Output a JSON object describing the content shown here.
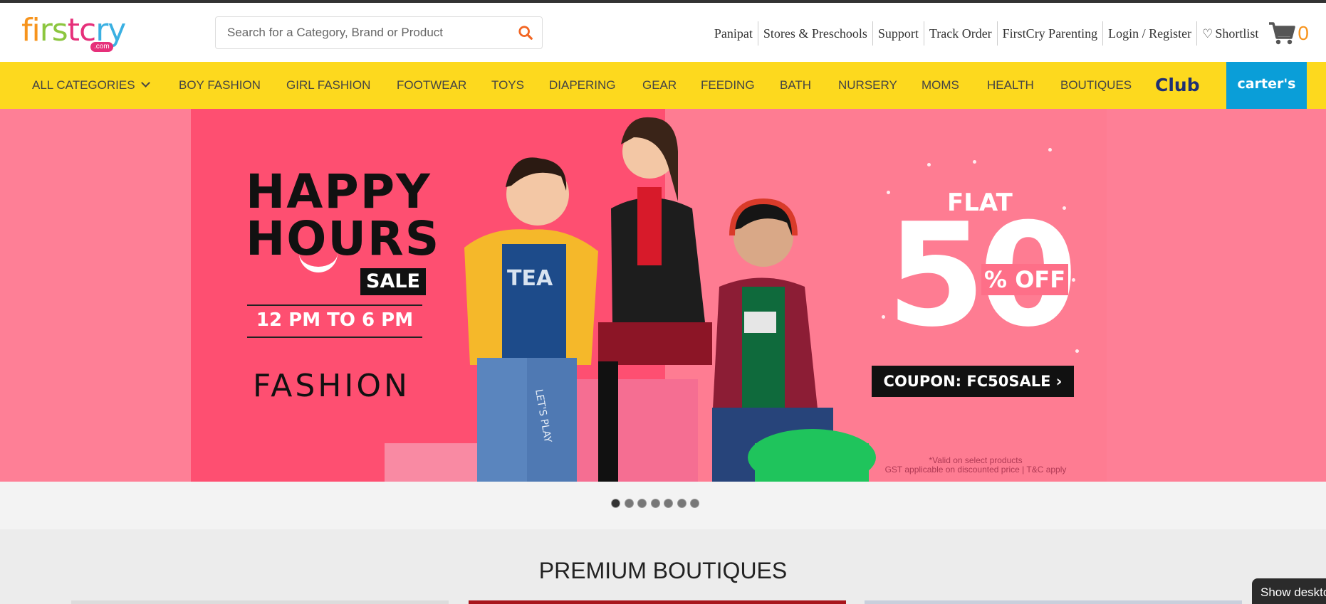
{
  "header": {
    "logo_text": "firstcry",
    "logo_sub": ".com",
    "search_placeholder": "Search for a Category, Brand or Product",
    "links": [
      "Panipat",
      "Stores & Preschools",
      "Support",
      "Track Order",
      "FirstCry Parenting",
      "Login / Register",
      "Shortlist"
    ],
    "cart_count": "0"
  },
  "nav": {
    "items": [
      "ALL CATEGORIES",
      "BOY FASHION",
      "GIRL FASHION",
      "FOOTWEAR",
      "TOYS",
      "DIAPERING",
      "GEAR",
      "FEEDING",
      "BATH",
      "NURSERY",
      "MOMS",
      "HEALTH",
      "BOUTIQUES"
    ],
    "club_label": "Club",
    "carters_label": "carter's"
  },
  "banner": {
    "line1": "HAPPY",
    "line2": "HOURS",
    "sale": "SALE",
    "time": "12 PM TO 6 PM",
    "category": "FASHION",
    "flat": "FLAT",
    "amount": "50",
    "off": "% OFF",
    "coupon": "COUPON: FC50SALE ›",
    "fine1": "*Valid on select products",
    "fine2": "GST applicable on discounted price | T&C apply",
    "shirt_text": "TEA",
    "jeans_text": "LET'S PLAY",
    "colors": {
      "left": "#fe4f71",
      "right": "#fe7c92",
      "outer": "#fe7f96"
    }
  },
  "carousel": {
    "count": 7,
    "active": 0
  },
  "boutiques": {
    "title": "PREMIUM BOUTIQUES"
  },
  "overlay": {
    "show_desktop": "Show deskto"
  },
  "colors": {
    "nav_bg": "#fdd91e",
    "accent": "#f7941d",
    "carters_bg": "#0a9ed8"
  }
}
